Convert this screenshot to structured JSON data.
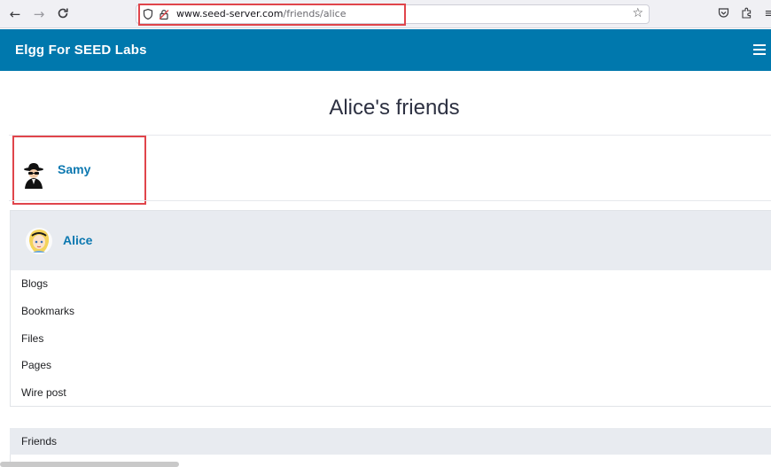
{
  "browser": {
    "url_host": "www.seed-server.com",
    "url_path": "/friends/alice"
  },
  "site": {
    "title": "Elgg For SEED Labs"
  },
  "page": {
    "title": "Alice's friends"
  },
  "friends": [
    {
      "name": "Samy"
    }
  ],
  "owner": {
    "name": "Alice",
    "menu": [
      "Blogs",
      "Bookmarks",
      "Files",
      "Pages",
      "Wire post"
    ]
  },
  "module": {
    "title": "Friends"
  },
  "colors": {
    "topbar": "#0078ad",
    "link": "#0c78b0",
    "highlight": "#e0454b"
  },
  "icons": {
    "back": "arrow-left-icon",
    "forward": "arrow-right-icon",
    "reload": "reload-icon",
    "shield": "shield-icon",
    "lock": "insecure-lock-icon",
    "bookmark": "star-icon",
    "pocket": "pocket-icon",
    "extensions": "extensions-icon",
    "menu": "hamburger-icon"
  }
}
